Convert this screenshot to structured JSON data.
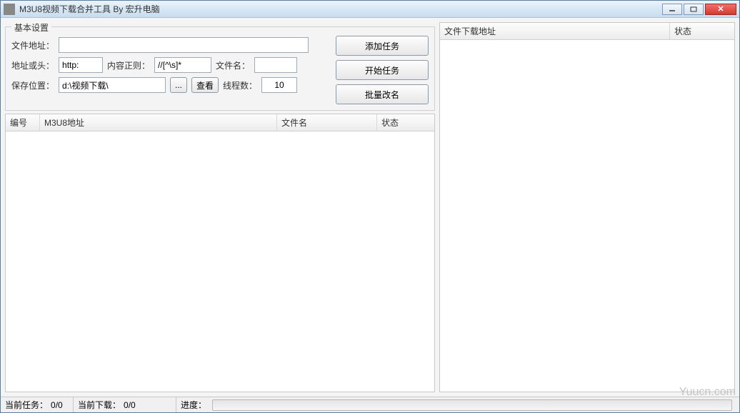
{
  "window": {
    "title": "M3U8视频下载合并工具 By 宏升电脑"
  },
  "settings": {
    "group_title": "基本设置",
    "file_url_label": "文件地址：",
    "file_url_value": "",
    "url_head_label": "地址或头：",
    "url_head_value": "http:",
    "regex_label": "内容正则：",
    "regex_value": "//[^\\s]*",
    "filename_label": "文件名：",
    "filename_value": "",
    "save_path_label": "保存位置：",
    "save_path_value": "d:\\视频下载\\",
    "browse_button": "...",
    "view_button": "查看",
    "threads_label": "线程数：",
    "threads_value": "10"
  },
  "actions": {
    "add_task": "添加任务",
    "start_task": "开始任务",
    "batch_rename": "批量改名"
  },
  "main_table": {
    "col_index": "编号",
    "col_url": "M3U8地址",
    "col_filename": "文件名",
    "col_status": "状态"
  },
  "side_table": {
    "col_url": "文件下载地址",
    "col_status": "状态"
  },
  "statusbar": {
    "current_task_label": "当前任务：",
    "current_task_value": "0/0",
    "current_download_label": "当前下载：",
    "current_download_value": "0/0",
    "progress_label": "进度："
  },
  "watermark": "Yuucn.com"
}
